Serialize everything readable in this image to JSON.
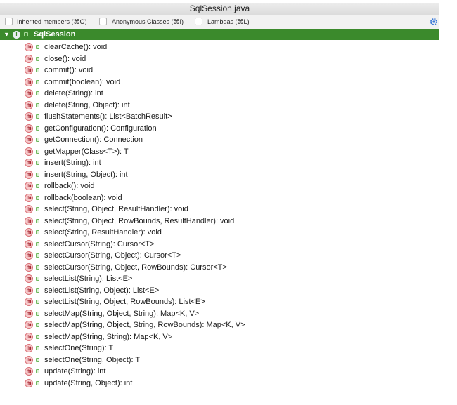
{
  "window": {
    "title": "SqlSession.java"
  },
  "toolbar": {
    "inherited_label": "Inherited members (⌘O)",
    "anonymous_label": "Anonymous Classes (⌘I)",
    "lambdas_label": "Lambdas (⌘L)",
    "settings_icon": "gear-icon"
  },
  "root": {
    "name": "SqlSession",
    "icon": "class-icon"
  },
  "methods": [
    "clearCache(): void",
    "close(): void",
    "commit(): void",
    "commit(boolean): void",
    "delete(String): int",
    "delete(String, Object): int",
    "flushStatements(): List<BatchResult>",
    "getConfiguration(): Configuration",
    "getConnection(): Connection",
    "getMapper(Class<T>): T",
    "insert(String): int",
    "insert(String, Object): int",
    "rollback(): void",
    "rollback(boolean): void",
    "select(String, Object, ResultHandler): void",
    "select(String, Object, RowBounds, ResultHandler): void",
    "select(String, ResultHandler): void",
    "selectCursor(String): Cursor<T>",
    "selectCursor(String, Object): Cursor<T>",
    "selectCursor(String, Object, RowBounds): Cursor<T>",
    "selectList(String): List<E>",
    "selectList(String, Object): List<E>",
    "selectList(String, Object, RowBounds): List<E>",
    "selectMap(String, Object, String): Map<K, V>",
    "selectMap(String, Object, String, RowBounds): Map<K, V>",
    "selectMap(String, String): Map<K, V>",
    "selectOne(String): T",
    "selectOne(String, Object): T",
    "update(String): int",
    "update(String, Object): int"
  ],
  "colors": {
    "selection": "#3b8a2c",
    "method_icon": "#f7c9cb"
  }
}
